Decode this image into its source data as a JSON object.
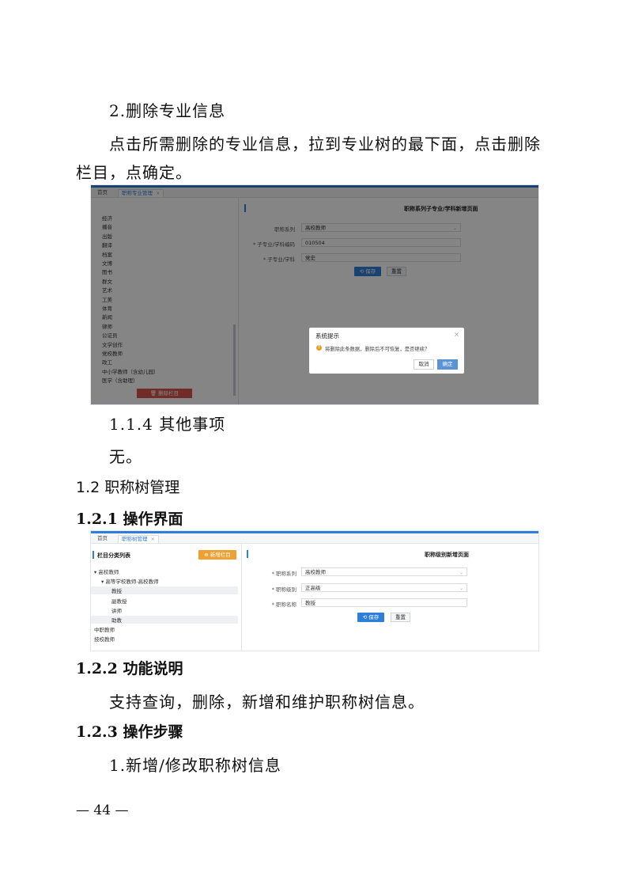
{
  "doc": {
    "p1": "2.删除专业信息",
    "p2_line1": "点击所需删除的专业信息，拉到专业树的最下面，点击删除",
    "p2_line2": "栏目，点确定。",
    "p3": "1.1.4 其他事项",
    "p4": "无。",
    "h1": "1.2 职称树管理",
    "h2": "1.2.1 操作界面",
    "h3": "1.2.2 功能说明",
    "p5": "支持查询，删除，新增和维护职称树信息。",
    "h4": "1.2.3 操作步骤",
    "p6": "1.新增/修改职称树信息",
    "page_number": "— 44 —"
  },
  "shot1": {
    "tab_home": "首页",
    "tab_active": "职称专业管理",
    "tab_close": "×",
    "tree_items": [
      "经济",
      "播音",
      "出版",
      "翻译",
      "档案",
      "文博",
      "图书",
      "群文",
      "艺术",
      "工美",
      "体育",
      "新闻",
      "律师",
      "公证员",
      "文学创作",
      "党校教师",
      "政工",
      "中小学教师（含幼儿园）",
      "医学（含助理）"
    ],
    "delete_button": "删除栏目",
    "form_title": "职称系列子专业/学科新增页面",
    "field1_label": "职称系列",
    "field1_value": "高校教师",
    "field2_label": "* 子专业/学科编码",
    "field2_value": "010504",
    "field3_label": "* 子专业/学科",
    "field3_value": "党史",
    "save_button": "保存",
    "reset_button": "重置",
    "dialog_title": "系统提示",
    "dialog_close": "×",
    "dialog_message": "将删除此条数据，删除后不可恢复，是否继续？",
    "cancel_button": "取消",
    "confirm_button": "确定"
  },
  "shot2": {
    "tab_home": "首页",
    "tab_active": "职称树管理",
    "tab_close": "×",
    "panel_title": "栏目分类列表",
    "add_button": "新增栏目",
    "tree": [
      {
        "label": "高校教师",
        "prefix": "▾",
        "level": 0
      },
      {
        "label": "高等学校教师-高校教师",
        "prefix": "▾",
        "level": 1
      },
      {
        "label": "教授",
        "prefix": "",
        "level": 2
      },
      {
        "label": "副教授",
        "prefix": "",
        "level": 2
      },
      {
        "label": "讲师",
        "prefix": "",
        "level": 2
      },
      {
        "label": "助教",
        "prefix": "",
        "level": 2
      },
      {
        "label": "中职教师",
        "prefix": "",
        "level": 0
      },
      {
        "label": "技校教师",
        "prefix": "",
        "level": 0
      }
    ],
    "form_title": "职称级别新增页面",
    "field1_label": "* 职称系列",
    "field1_value": "高校教师",
    "field2_label": "* 职称级别",
    "field2_value": "正高级",
    "field3_label": "* 职称名称",
    "field3_value": "教授",
    "save_button": "保存",
    "reset_button": "重置"
  },
  "colors": {
    "accent": "#2f7fd8",
    "danger": "#d9534f",
    "warning": "#f0a020",
    "add_orange": "#f0a030"
  }
}
